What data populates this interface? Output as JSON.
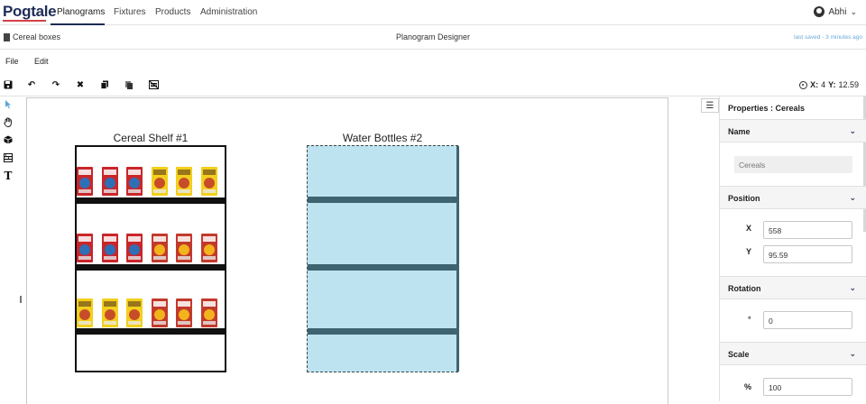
{
  "brand": "Pogtale",
  "nav": [
    "Planograms",
    "Fixtures",
    "Products",
    "Administration"
  ],
  "user": {
    "name": "Abhi"
  },
  "doc": {
    "title": "Cereal boxes",
    "designer": "Planogram Designer",
    "last_saved": "last saved - 3 minutes ago"
  },
  "menu": [
    "File",
    "Edit"
  ],
  "coords": {
    "x_label": "X:",
    "x_value": "4",
    "y_label": "Y:",
    "y_value": "12.59"
  },
  "icons": {
    "toolbar": [
      "save-icon",
      "undo-icon",
      "redo-icon",
      "delete-icon",
      "copy-icon",
      "paste-icon",
      "clear-icon"
    ],
    "tools": [
      "pointer-icon",
      "hand-icon",
      "box-icon",
      "fixture-icon",
      "text-icon"
    ]
  },
  "fixtures": [
    {
      "label": "Cereal Shelf #1",
      "type": "shelf",
      "rows": [
        [
          "capn",
          "capn",
          "capn",
          "cheerio",
          "cheerio",
          "cheerio"
        ],
        [
          "capn",
          "capn",
          "capn",
          "fruit",
          "fruit",
          "fruit"
        ],
        [
          "cheerio",
          "cheerio",
          "cheerio",
          "fruit",
          "fruit",
          "fruit"
        ]
      ]
    },
    {
      "label": "Water Bottles #2",
      "type": "water",
      "rows": []
    }
  ],
  "colors": {
    "brand": "#1e2c55",
    "brand_accent": "#d2424a",
    "water": "#bde3f0",
    "water_shelf": "#3d6470",
    "link": "#6aa9d8"
  },
  "panel": {
    "title": "Properties : Cereals",
    "sections": {
      "name": {
        "label": "Name",
        "value": "Cereals"
      },
      "position": {
        "label": "Position",
        "x_label": "X",
        "x": "558",
        "y_label": "Y",
        "y": "95.59"
      },
      "rotation": {
        "label": "Rotation",
        "unit": "°",
        "value": "0"
      },
      "scale": {
        "label": "Scale",
        "unit": "%",
        "value": "100"
      }
    }
  }
}
